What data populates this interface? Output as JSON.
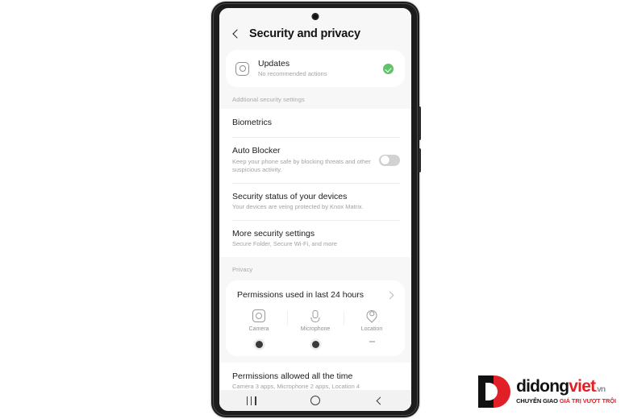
{
  "app": {
    "title": "Security and privacy",
    "back_icon": "back-chevron-icon"
  },
  "updates": {
    "icon": "software-update-icon",
    "title": "Updates",
    "subtitle": "No recommended actions",
    "status_icon": "green-check-icon",
    "status_color": "#5fc36a"
  },
  "additional_section": {
    "label": "Addtional security settings",
    "rows": [
      {
        "title": "Biometrics",
        "subtitle": ""
      },
      {
        "title": "Auto Blocker",
        "subtitle": "Keep your phone safe by blocking threats and other suspicious activity.",
        "toggle": "off"
      },
      {
        "title": "Security status of your devices",
        "subtitle": "Your devices are veing protected by Knox Matrix."
      },
      {
        "title": "More security settings",
        "subtitle": "Secure Folder, Secure Wi-Fi, and more"
      }
    ]
  },
  "privacy_section": {
    "label": "Privacy",
    "permissions_card": {
      "header": "Permissions used in last 24 hours",
      "chevron_icon": "chevron-right-icon",
      "items": [
        {
          "icon": "camera-icon",
          "label": "Camera",
          "indicator": "dot"
        },
        {
          "icon": "microphone-icon",
          "label": "Microphone",
          "indicator": "dot"
        },
        {
          "icon": "location-icon",
          "label": "Location",
          "indicator": "dash"
        }
      ]
    },
    "allowed_row": {
      "title": "Permissions allowed all the time",
      "subtitle": "Camera 3 apps, Microphone 2 apps, Location 4"
    }
  },
  "nav_bar": {
    "recents": "recents-icon",
    "home": "home-icon",
    "back": "back-icon"
  },
  "watermark": {
    "brand_part1": "didong",
    "brand_part2": "viet",
    "brand_tld": ".vn",
    "tagline_part1": "CHUYỂN GIAO ",
    "tagline_part2": "GIÁ TRỊ VƯỢT TRỘI",
    "brand_color": "#e11f26"
  }
}
